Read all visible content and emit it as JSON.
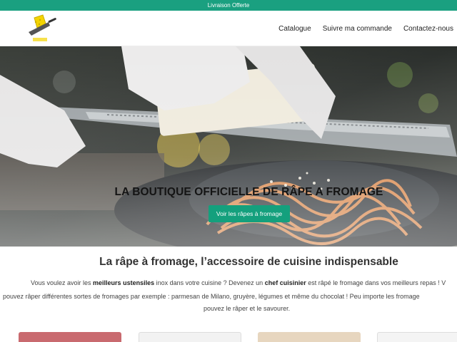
{
  "topbar": {
    "text": "Livraison Offerte"
  },
  "header": {
    "nav": [
      {
        "label": "Catalogue"
      },
      {
        "label": "Suivre ma commande"
      },
      {
        "label": "Contactez-nous"
      }
    ]
  },
  "hero": {
    "title": "LA BOUTIQUE OFFICIELLE DE RÂPE A FROMAGE",
    "cta_label": "Voir les râpes à fromage"
  },
  "intro": {
    "title": "La râpe à fromage, l’accessoire de cuisine indispensable",
    "line1": {
      "before": "Vous voulez avoir les ",
      "bold1": "meilleurs ustensiles",
      "mid": " inox dans votre cuisine ? Devenez un ",
      "bold2": "chef cuisinier",
      "after": " est râpé le fromage dans vos meilleurs repas ! V"
    },
    "line2": "pouvez râper différentes sortes de fromages par exemple : parmesan de Milano, gruyère, légumes et même du chocolat ! Peu importe les fromage",
    "line3": "pouvez le râper et le savourer."
  },
  "colors": {
    "accent": "#14a07d",
    "topbar": "#1aa080"
  },
  "icons": {
    "logo": "cheese-grater-logo-icon"
  }
}
